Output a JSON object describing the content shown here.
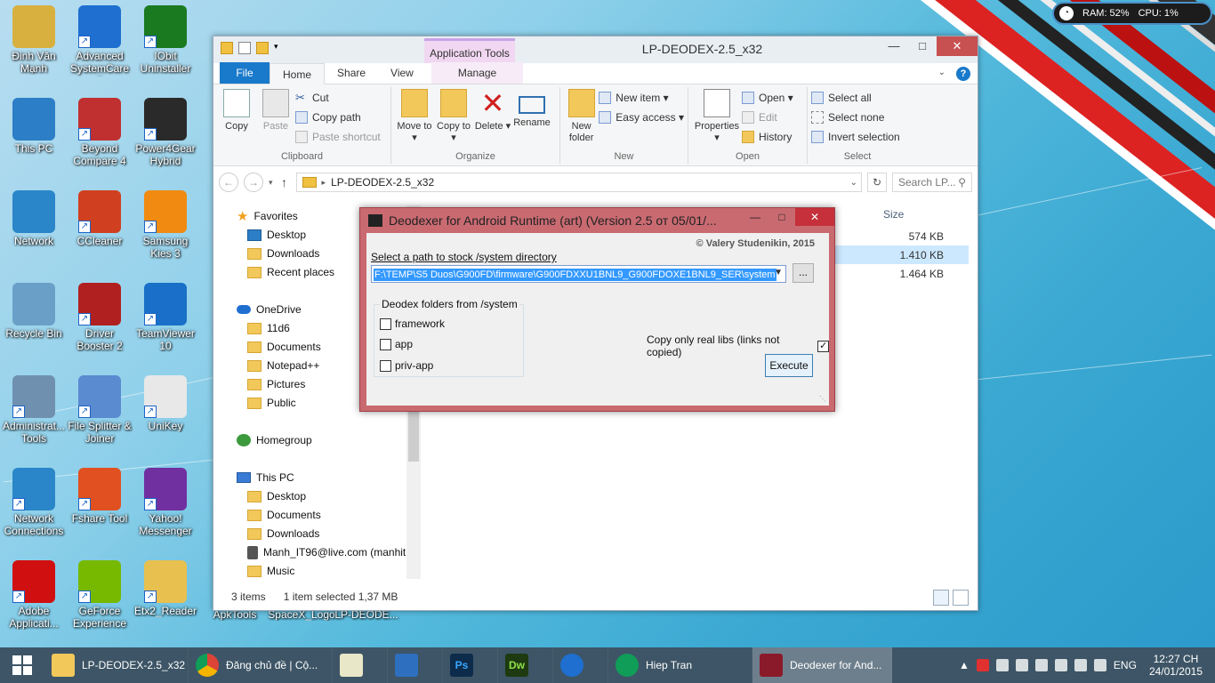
{
  "desktop": {
    "icons": [
      {
        "label": "Đinh Văn Mạnh",
        "color": "#d8b040"
      },
      {
        "label": "Advanced SystemCare 8",
        "color": "#1e6fd0"
      },
      {
        "label": "IObit Uninstaller",
        "color": "#1a7a20"
      },
      {
        "label": "This PC",
        "color": "#2c7ec6"
      },
      {
        "label": "Beyond Compare 4",
        "color": "#c03030"
      },
      {
        "label": "Power4Gear Hybrid",
        "color": "#2a2a2a"
      },
      {
        "label": "Network",
        "color": "#2a86c8"
      },
      {
        "label": "CCleaner",
        "color": "#d04020"
      },
      {
        "label": "Samsung Kies 3",
        "color": "#f08a10"
      },
      {
        "label": "Recycle Bin",
        "color": "#6aa0c8"
      },
      {
        "label": "Driver Booster 2",
        "color": "#b02020"
      },
      {
        "label": "TeamViewer 10",
        "color": "#1a70c8"
      },
      {
        "label": "Administrat... Tools",
        "color": "#7090b0"
      },
      {
        "label": "File Splitter & Joiner",
        "color": "#5a8ad0"
      },
      {
        "label": "UniKey",
        "color": "#e8e8e8"
      },
      {
        "label": "Network Connections",
        "color": "#2a86c8"
      },
      {
        "label": "Fshare Tool",
        "color": "#e05020"
      },
      {
        "label": "Yahoo! Messenger",
        "color": "#7030a0"
      },
      {
        "label": "Adobe Applicati...",
        "color": "#d01010"
      },
      {
        "label": "GeForce Experience",
        "color": "#76b900"
      },
      {
        "label": "Etx2_Reader",
        "color": "#e8c050"
      }
    ],
    "partial_labels": [
      "ApkTools",
      "SpaceX_Logo",
      "LP-DEODE..."
    ]
  },
  "sysmon": {
    "ram": "RAM: 52%",
    "cpu": "CPU: 1%"
  },
  "explorer": {
    "title": "LP-DEODEX-2.5_x32",
    "app_tools": "Application Tools",
    "tabs": {
      "file": "File",
      "home": "Home",
      "share": "Share",
      "view": "View",
      "manage": "Manage"
    },
    "ribbon": {
      "copy": "Copy",
      "paste": "Paste",
      "cut": "Cut",
      "copy_path": "Copy path",
      "paste_shortcut": "Paste shortcut",
      "clipboard": "Clipboard",
      "move_to": "Move to ▾",
      "copy_to": "Copy to ▾",
      "delete": "Delete ▾",
      "rename": "Rename",
      "organize": "Organize",
      "new_folder": "New folder",
      "new_item": "New item ▾",
      "easy_access": "Easy access ▾",
      "new": "New",
      "properties": "Properties ▾",
      "open": "Open ▾",
      "edit": "Edit",
      "history": "History",
      "open_group": "Open",
      "select_all": "Select all",
      "select_none": "Select none",
      "invert_selection": "Invert selection",
      "select": "Select"
    },
    "address": "LP-DEODEX-2.5_x32",
    "search_placeholder": "Search LP...",
    "nav": {
      "favorites": "Favorites",
      "desktop": "Desktop",
      "downloads": "Downloads",
      "recent_places": "Recent places",
      "onedrive": "OneDrive",
      "od_11d6": "11d6",
      "od_documents": "Documents",
      "od_notepad": "Notepad++",
      "od_pictures": "Pictures",
      "od_public": "Public",
      "homegroup": "Homegroup",
      "this_pc": "This PC",
      "pc_desktop": "Desktop",
      "pc_documents": "Documents",
      "pc_downloads": "Downloads",
      "pc_phone": "Manh_IT96@live.com (manhit",
      "pc_music": "Music"
    },
    "columns": {
      "size": "Size"
    },
    "files": [
      {
        "size": "574 KB",
        "selected": false
      },
      {
        "size": "1.410 KB",
        "selected": true
      },
      {
        "size": "1.464 KB",
        "selected": false
      }
    ],
    "status": {
      "items": "3 items",
      "selected": "1 item selected  1,37 MB"
    }
  },
  "deodexer": {
    "title": "Deodexer for Android Runtime (art) (Version 2.5 от 05/01/...",
    "copyright": "© Valery Studenikin, 2015",
    "path_label": "Select a path to stock /system directory",
    "path_value": "F:\\TEMP\\S5 Duos\\G900FD\\firmware\\G900FDXXU1BNL9_G900FDOXE1BNL9_SER\\system",
    "browse": "...",
    "group_title": "Deodex folders from  /system",
    "folders": {
      "framework": "framework",
      "app": "app",
      "priv_app": "priv-app"
    },
    "copy_libs": "Copy only real libs (links not copied)",
    "copy_libs_checked": true,
    "execute": "Execute"
  },
  "taskbar": {
    "explorer": "LP-DEODEX-2.5_x32",
    "chrome": "Đăng chủ đề | Cộ...",
    "hangouts": "Hiep Tran",
    "deodexer": "Deodexer for And...",
    "lang": "ENG",
    "time": "12:27 CH",
    "date": "24/01/2015"
  }
}
